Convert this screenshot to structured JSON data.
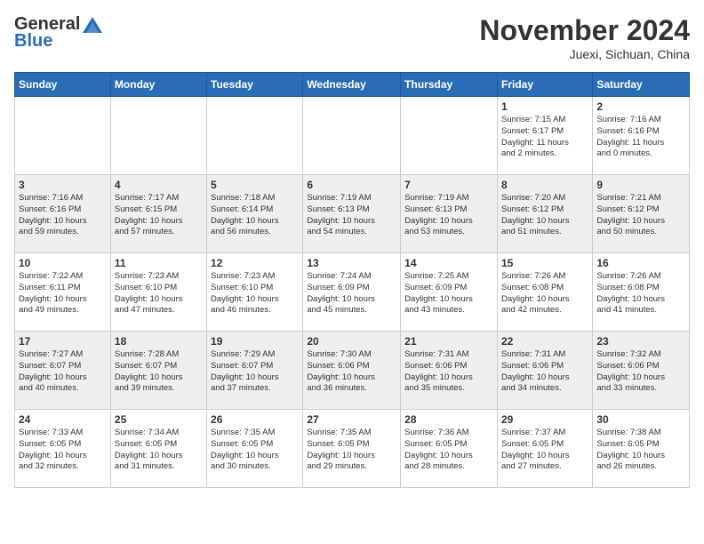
{
  "header": {
    "logo_general": "General",
    "logo_blue": "Blue",
    "month": "November 2024",
    "location": "Juexi, Sichuan, China"
  },
  "weekdays": [
    "Sunday",
    "Monday",
    "Tuesday",
    "Wednesday",
    "Thursday",
    "Friday",
    "Saturday"
  ],
  "weeks": [
    [
      {
        "day": "",
        "info": ""
      },
      {
        "day": "",
        "info": ""
      },
      {
        "day": "",
        "info": ""
      },
      {
        "day": "",
        "info": ""
      },
      {
        "day": "",
        "info": ""
      },
      {
        "day": "1",
        "info": "Sunrise: 7:15 AM\nSunset: 6:17 PM\nDaylight: 11 hours\nand 2 minutes."
      },
      {
        "day": "2",
        "info": "Sunrise: 7:16 AM\nSunset: 6:16 PM\nDaylight: 11 hours\nand 0 minutes."
      }
    ],
    [
      {
        "day": "3",
        "info": "Sunrise: 7:16 AM\nSunset: 6:16 PM\nDaylight: 10 hours\nand 59 minutes."
      },
      {
        "day": "4",
        "info": "Sunrise: 7:17 AM\nSunset: 6:15 PM\nDaylight: 10 hours\nand 57 minutes."
      },
      {
        "day": "5",
        "info": "Sunrise: 7:18 AM\nSunset: 6:14 PM\nDaylight: 10 hours\nand 56 minutes."
      },
      {
        "day": "6",
        "info": "Sunrise: 7:19 AM\nSunset: 6:13 PM\nDaylight: 10 hours\nand 54 minutes."
      },
      {
        "day": "7",
        "info": "Sunrise: 7:19 AM\nSunset: 6:13 PM\nDaylight: 10 hours\nand 53 minutes."
      },
      {
        "day": "8",
        "info": "Sunrise: 7:20 AM\nSunset: 6:12 PM\nDaylight: 10 hours\nand 51 minutes."
      },
      {
        "day": "9",
        "info": "Sunrise: 7:21 AM\nSunset: 6:12 PM\nDaylight: 10 hours\nand 50 minutes."
      }
    ],
    [
      {
        "day": "10",
        "info": "Sunrise: 7:22 AM\nSunset: 6:11 PM\nDaylight: 10 hours\nand 49 minutes."
      },
      {
        "day": "11",
        "info": "Sunrise: 7:23 AM\nSunset: 6:10 PM\nDaylight: 10 hours\nand 47 minutes."
      },
      {
        "day": "12",
        "info": "Sunrise: 7:23 AM\nSunset: 6:10 PM\nDaylight: 10 hours\nand 46 minutes."
      },
      {
        "day": "13",
        "info": "Sunrise: 7:24 AM\nSunset: 6:09 PM\nDaylight: 10 hours\nand 45 minutes."
      },
      {
        "day": "14",
        "info": "Sunrise: 7:25 AM\nSunset: 6:09 PM\nDaylight: 10 hours\nand 43 minutes."
      },
      {
        "day": "15",
        "info": "Sunrise: 7:26 AM\nSunset: 6:08 PM\nDaylight: 10 hours\nand 42 minutes."
      },
      {
        "day": "16",
        "info": "Sunrise: 7:26 AM\nSunset: 6:08 PM\nDaylight: 10 hours\nand 41 minutes."
      }
    ],
    [
      {
        "day": "17",
        "info": "Sunrise: 7:27 AM\nSunset: 6:07 PM\nDaylight: 10 hours\nand 40 minutes."
      },
      {
        "day": "18",
        "info": "Sunrise: 7:28 AM\nSunset: 6:07 PM\nDaylight: 10 hours\nand 39 minutes."
      },
      {
        "day": "19",
        "info": "Sunrise: 7:29 AM\nSunset: 6:07 PM\nDaylight: 10 hours\nand 37 minutes."
      },
      {
        "day": "20",
        "info": "Sunrise: 7:30 AM\nSunset: 6:06 PM\nDaylight: 10 hours\nand 36 minutes."
      },
      {
        "day": "21",
        "info": "Sunrise: 7:31 AM\nSunset: 6:06 PM\nDaylight: 10 hours\nand 35 minutes."
      },
      {
        "day": "22",
        "info": "Sunrise: 7:31 AM\nSunset: 6:06 PM\nDaylight: 10 hours\nand 34 minutes."
      },
      {
        "day": "23",
        "info": "Sunrise: 7:32 AM\nSunset: 6:06 PM\nDaylight: 10 hours\nand 33 minutes."
      }
    ],
    [
      {
        "day": "24",
        "info": "Sunrise: 7:33 AM\nSunset: 6:05 PM\nDaylight: 10 hours\nand 32 minutes."
      },
      {
        "day": "25",
        "info": "Sunrise: 7:34 AM\nSunset: 6:05 PM\nDaylight: 10 hours\nand 31 minutes."
      },
      {
        "day": "26",
        "info": "Sunrise: 7:35 AM\nSunset: 6:05 PM\nDaylight: 10 hours\nand 30 minutes."
      },
      {
        "day": "27",
        "info": "Sunrise: 7:35 AM\nSunset: 6:05 PM\nDaylight: 10 hours\nand 29 minutes."
      },
      {
        "day": "28",
        "info": "Sunrise: 7:36 AM\nSunset: 6:05 PM\nDaylight: 10 hours\nand 28 minutes."
      },
      {
        "day": "29",
        "info": "Sunrise: 7:37 AM\nSunset: 6:05 PM\nDaylight: 10 hours\nand 27 minutes."
      },
      {
        "day": "30",
        "info": "Sunrise: 7:38 AM\nSunset: 6:05 PM\nDaylight: 10 hours\nand 26 minutes."
      }
    ]
  ]
}
